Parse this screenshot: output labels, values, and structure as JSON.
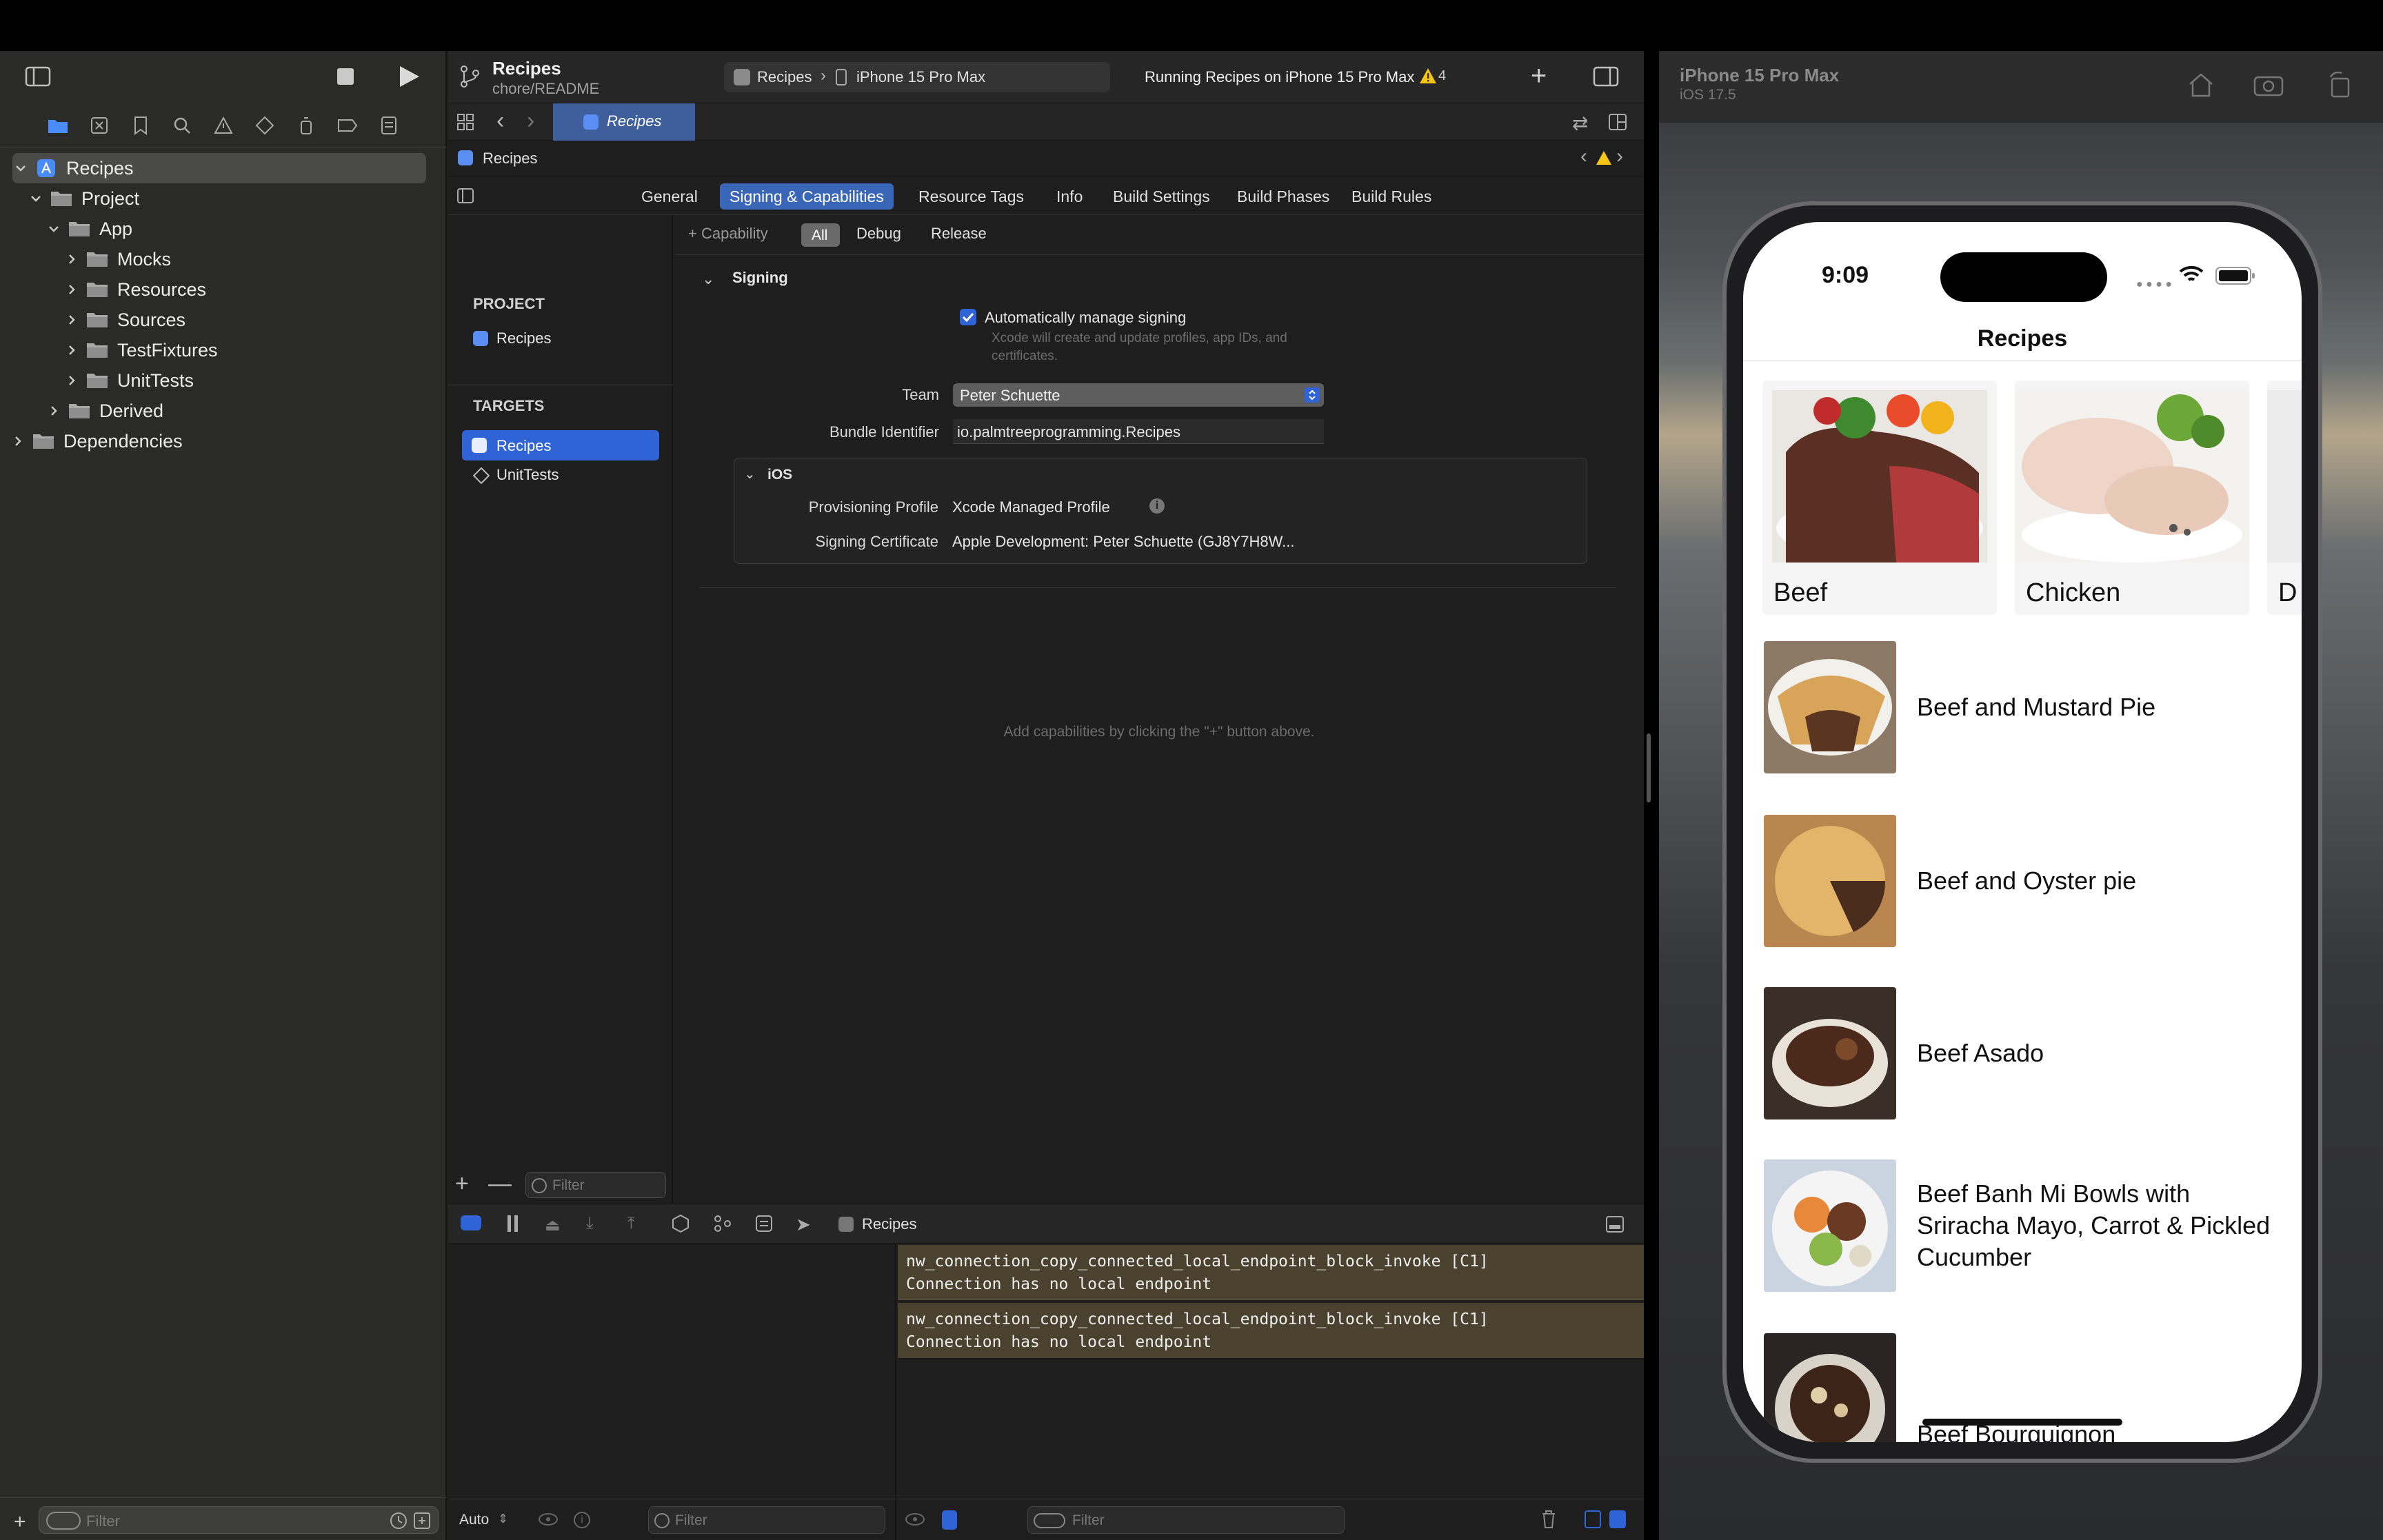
{
  "toolbar": {
    "project_name": "Recipes",
    "branch": "chore/README",
    "scheme": "Recipes",
    "destination": "iPhone 15 Pro Max",
    "status": "Running Recipes on iPhone 15 Pro Max",
    "warnings_count": "4"
  },
  "editor_tab": {
    "label": "Recipes"
  },
  "jumpbar": {
    "label": "Recipes"
  },
  "settings_tabs": [
    "General",
    "Signing & Capabilities",
    "Resource Tags",
    "Info",
    "Build Settings",
    "Build Phases",
    "Build Rules"
  ],
  "capability_bar": {
    "add_label": "+ Capability",
    "filters": [
      "All",
      "Debug",
      "Release"
    ]
  },
  "targets_pane": {
    "project_header": "PROJECT",
    "project_item": "Recipes",
    "targets_header": "TARGETS",
    "targets": [
      "Recipes",
      "UnitTests"
    ],
    "filter_placeholder": "Filter"
  },
  "navigator": {
    "items": [
      {
        "label": "Recipes",
        "depth": 0,
        "expanded": true
      },
      {
        "label": "Project",
        "depth": 1,
        "expanded": true
      },
      {
        "label": "App",
        "depth": 2,
        "expanded": true
      },
      {
        "label": "Mocks",
        "depth": 3,
        "expanded": false
      },
      {
        "label": "Resources",
        "depth": 3,
        "expanded": false
      },
      {
        "label": "Sources",
        "depth": 3,
        "expanded": false
      },
      {
        "label": "TestFixtures",
        "depth": 3,
        "expanded": false
      },
      {
        "label": "UnitTests",
        "depth": 3,
        "expanded": false
      },
      {
        "label": "Derived",
        "depth": 2,
        "expanded": false
      },
      {
        "label": "Dependencies",
        "depth": 0,
        "expanded": false
      }
    ],
    "filter_placeholder": "Filter"
  },
  "signing": {
    "section_title": "Signing",
    "auto_manage_label": "Automatically manage signing",
    "auto_manage_checked": true,
    "auto_manage_hint": "Xcode will create and update profiles, app IDs, and certificates.",
    "team_label": "Team",
    "team_value": "Peter Schuette",
    "bundle_label": "Bundle Identifier",
    "bundle_value": "io.palmtreeprogramming.Recipes",
    "ios_section": "iOS",
    "profile_label": "Provisioning Profile",
    "profile_value": "Xcode Managed Profile",
    "cert_label": "Signing Certificate",
    "cert_value": "Apple Development: Peter Schuette (GJ8Y7H8W..."
  },
  "capabilities_hint": "Add capabilities by clicking the \"+\" button above.",
  "debug_bar": {
    "process": "Recipes",
    "auto_label": "Auto",
    "filter_placeholder": "Filter",
    "console_filter_placeholder": "Filter"
  },
  "console": {
    "lines": [
      "nw_connection_copy_connected_local_endpoint_block_invoke [C1]\nConnection has no local endpoint",
      "nw_connection_copy_connected_local_endpoint_block_invoke [C1]\nConnection has no local endpoint"
    ]
  },
  "simulator": {
    "device": "iPhone 15 Pro Max",
    "os": "iOS 17.5",
    "status_time": "9:09",
    "app_title": "Recipes",
    "categories": [
      "Beef",
      "Chicken",
      "D"
    ],
    "recipes": [
      "Beef and Mustard Pie",
      "Beef and Oyster pie",
      "Beef Asado",
      "Beef Banh Mi Bowls with Sriracha Mayo, Carrot & Pickled Cucumber",
      "Beef Bourguignon"
    ]
  },
  "colors": {
    "accent": "#3a66b8",
    "warning": "#f5c518",
    "console_highlight": "#4a412e"
  }
}
